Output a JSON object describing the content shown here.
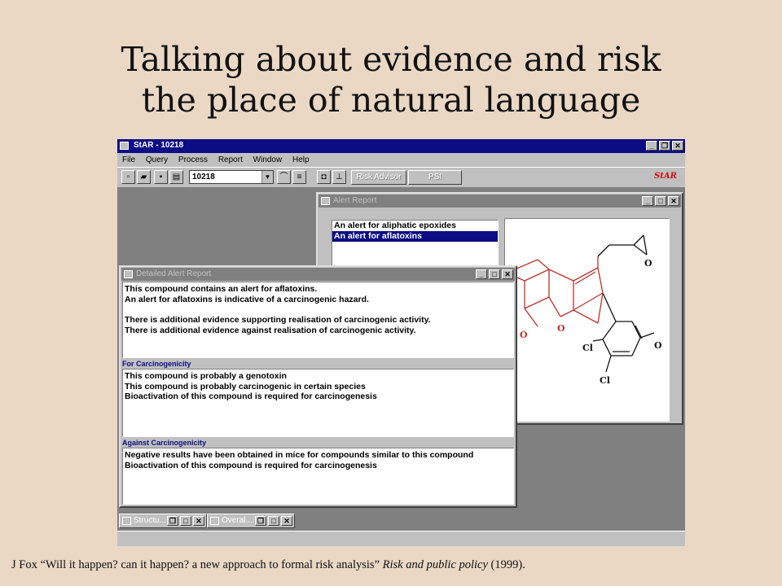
{
  "slide": {
    "title_line1": "Talking about evidence and risk",
    "title_line2": "the place of natural language"
  },
  "app": {
    "title": "StAR - 10218",
    "menu": [
      "File",
      "Query",
      "Process",
      "Report",
      "Window",
      "Help"
    ],
    "compound_id": "10218",
    "risk_advisor_label": "Risk Advisor",
    "psi_label": "PSI",
    "logo_text": "StAR"
  },
  "alert_report": {
    "title": "Alert Report",
    "alerts": [
      "An alert for aliphatic epoxides",
      "An alert for aflatoxins"
    ],
    "selected_index": 1,
    "molecule_labels": [
      "O",
      "O",
      "O",
      "Cl",
      "O",
      "Cl"
    ]
  },
  "detail_report": {
    "title": "Detailed Alert Report",
    "summary": [
      "This compound contains an alert for aflatoxins.",
      "An alert for aflatoxins is indicative of a carcinogenic hazard.",
      "There is additional evidence supporting realisation of carcinogenic activity.",
      "There is additional evidence against realisation of carcinogenic activity."
    ],
    "for_label": "For Carcinogenicity",
    "for_items": [
      "This compound is probably a genotoxin",
      "This compound is probably carcinogenic in certain species",
      "Bioactivation of this compound is required for carcinogenesis"
    ],
    "against_label": "Against Carcinogenicity",
    "against_items": [
      "Negative results have been obtained in mice for compounds similar to this compound",
      "Bioactivation of this compound is required for carcinogenesis"
    ]
  },
  "minimized": [
    "Structu...",
    "Overal..."
  ],
  "citation": {
    "author": "J Fox ",
    "quote": "“Will it happen? can it happen? a new approach to formal risk analysis” ",
    "journal": "Risk and public policy",
    "year": " (1999)."
  },
  "colors": {
    "active_title": "#0c0c84",
    "inactive_title": "#808080",
    "mdi_background": "#808080",
    "molecule_red": "#c0302a",
    "molecule_black": "#111111"
  }
}
